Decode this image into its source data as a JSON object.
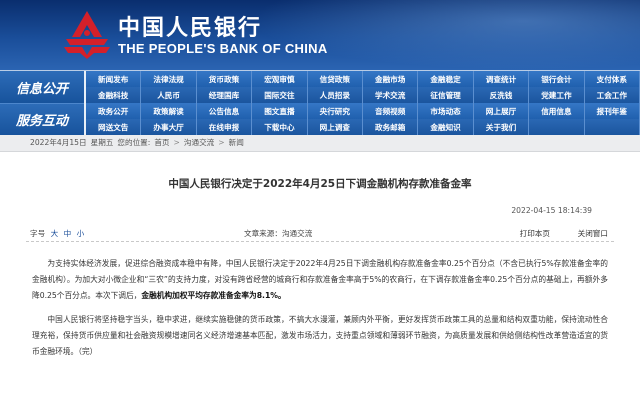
{
  "header": {
    "title_cn": "中国人民银行",
    "title_en": "THE PEOPLE'S BANK OF CHINA",
    "brand_color": "#1a4e9a",
    "logo_color": "#d4202a"
  },
  "nav": {
    "group1_label": "信息公开",
    "group2_label": "服务互动",
    "row1": [
      "新闻发布",
      "法律法规",
      "货币政策",
      "宏观审慎",
      "信贷政策",
      "金融市场",
      "金融稳定",
      "调查统计",
      "银行会计",
      "支付体系"
    ],
    "row2": [
      "金融科技",
      "人民币",
      "经理国库",
      "国际交往",
      "人员招录",
      "学术交流",
      "征信管理",
      "反洗钱",
      "党建工作",
      "工会工作"
    ],
    "row3": [
      "政务公开",
      "政策解读",
      "公告信息",
      "图文直播",
      "央行研究",
      "音频视频",
      "市场动态",
      "网上展厅",
      "信用信息",
      "报刊年鉴"
    ],
    "row4": [
      "网送文告",
      "办事大厅",
      "在线申报",
      "下载中心",
      "网上调查",
      "政务邮箱",
      "金融知识",
      "关于我们",
      "",
      ""
    ]
  },
  "breadcrumb": {
    "date": "2022年4月15日",
    "weekday": "星期五",
    "location_label": "您的位置:",
    "home": "首页",
    "section": "沟通交流",
    "current": "新闻",
    "separator": ">"
  },
  "article": {
    "title": "中国人民银行决定于2022年4月25日下调金融机构存款准备金率",
    "publish_time": "2022-04-15 18:14:39",
    "font_size_label": "字号",
    "font_large": "大",
    "font_medium": "中",
    "font_small": "小",
    "source": "文章来源：沟通交流",
    "print_label": "打印本页",
    "close_label": "关闭窗口",
    "paragraph1_pre": "为支持实体经济发展，促进综合融资成本稳中有降，中国人民银行决定于2022年4月25日下调金融机构存款准备金率0.25个百分点（不含已执行5%存款准备金率的金融机构）。为加大对小微企业和“三农”的支持力度，对没有跨省经营的城商行和存款准备金率高于5%的农商行，在下调存款准备金率0.25个百分点的基础上，再额外多降0.25个百分点。本次下调后，",
    "paragraph1_bold": "金融机构加权平均存款准备金率为8.1%。",
    "paragraph2": "中国人民银行将坚持稳字当头，稳中求进，继续实施稳健的货币政策，不搞大水漫灌，兼顾内外平衡，更好发挥货币政策工具的总量和结构双重功能，保持流动性合理充裕，保持货币供应量和社会融资规模增速同名义经济增速基本匹配，激发市场活力，支持重点领域和薄弱环节融资，为高质量发展和供给侧结构性改革营造适宜的货币金融环境。（完）"
  }
}
